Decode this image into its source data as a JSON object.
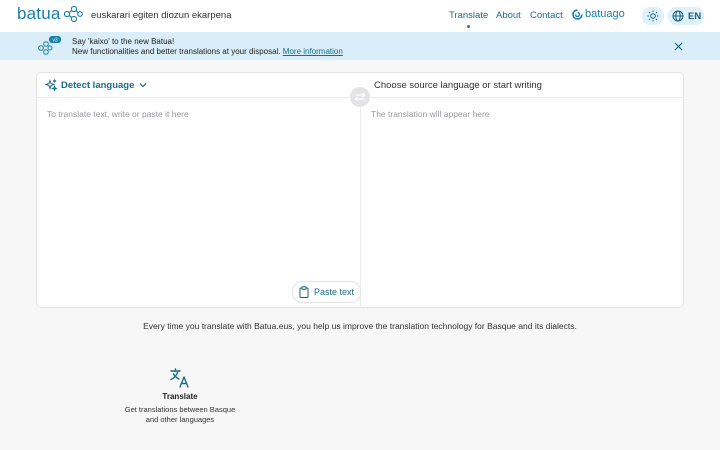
{
  "header": {
    "logo_text": "batua",
    "tagline": "euskarari egiten diozun ekarpena",
    "nav": [
      {
        "label": "Translate",
        "active": true
      },
      {
        "label": "About",
        "active": false
      },
      {
        "label": "Contact",
        "active": false
      }
    ],
    "batuago_label": "batuago",
    "language_code": "EN"
  },
  "banner": {
    "badge": "v3",
    "title": "Say 'kaixo' to the new Batua!",
    "description": "New functionalities and better translations at your disposal.",
    "link": "More information"
  },
  "translator": {
    "source_language": "Detect language",
    "target_language": "Choose source language or start writing",
    "source_placeholder": "To translate text, write or paste it here",
    "target_placeholder": "The translation will appear here",
    "paste_label": "Paste text"
  },
  "info_text": "Every time you translate with Batua.eus, you help us improve the translation technology for Basque and its dialects.",
  "feature": {
    "title": "Translate",
    "description_line1": "Get translations between Basque",
    "description_line2": "and other languages"
  },
  "colors": {
    "accent": "#1a7fa8",
    "banner_bg": "#d9eef8",
    "page_bg": "#f7f7f8"
  }
}
